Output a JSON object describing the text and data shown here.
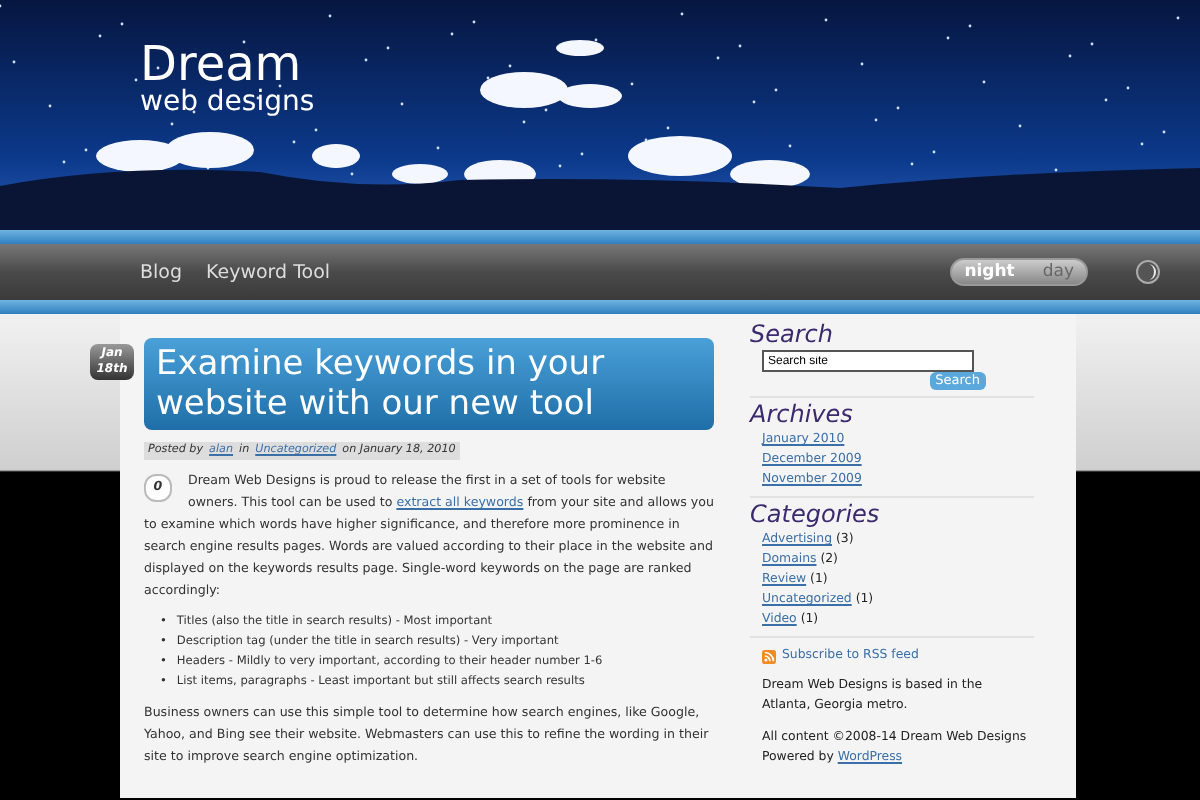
{
  "site": {
    "title": "Dream",
    "subtitle": "web designs"
  },
  "nav": {
    "links": [
      {
        "label": "Blog"
      },
      {
        "label": "Keyword Tool"
      }
    ],
    "theme_toggle": [
      {
        "label": "night",
        "selected": true
      },
      {
        "label": "day",
        "selected": false
      }
    ]
  },
  "post": {
    "date": {
      "month": "Jan",
      "day": "18th"
    },
    "title": "Examine keywords in your website with our new tool",
    "meta": {
      "prefix": "Posted by",
      "author": "alan",
      "middle": "in",
      "category": "Uncategorized",
      "suffix": "on January 18, 2010"
    },
    "comment_count": "0",
    "intro": [
      {
        "kind": "text",
        "text": "Dream Web Designs is proud to release the first in a set of tools for website owners. This tool can be used to "
      },
      {
        "kind": "link",
        "text": "extract all keywords"
      },
      {
        "kind": "text",
        "text": " from your site and allows you to examine which words have higher significance, and therefore more prominence in search engine results pages. Words are valued according to their place in the website and displayed on the keywords results page. Single-word keywords on the page are ranked accordingly:"
      }
    ],
    "list": [
      {
        "marker": "•",
        "text": "Titles (also the title in search results) - Most important"
      },
      {
        "marker": "•",
        "text": "Description tag (under the title in search results) - Very important"
      },
      {
        "marker": "•",
        "text": "Headers - Mildly to very important, according to their header number 1-6"
      },
      {
        "marker": "•",
        "text": "List items, paragraphs - Least important but still affects search results"
      }
    ],
    "closing": "Business owners can use this simple tool to determine how search engines, like Google, Yahoo, and Bing see their website. Webmasters can use this to refine the wording in their site to improve search engine optimization."
  },
  "sidebar": {
    "search": {
      "heading": "Search",
      "value": "Search site",
      "button": "Search"
    },
    "archives": {
      "heading": "Archives",
      "links": [
        "January 2010",
        "December 2009",
        "November 2009"
      ]
    },
    "categories": {
      "heading": "Categories",
      "items": [
        {
          "label": "Advertising",
          "count": "(3)"
        },
        {
          "label": "Domains",
          "count": "(2)"
        },
        {
          "label": "Review",
          "count": "(1)"
        },
        {
          "label": "Uncategorized",
          "count": "(1)"
        },
        {
          "label": "Video",
          "count": "(1)"
        }
      ]
    },
    "rss": "Subscribe to RSS feed",
    "about": "Dream Web Designs is based in the Atlanta, Georgia metro.",
    "copyright": "All content ©2008-14 Dream Web Designs",
    "powered": {
      "prefix": "Powered by",
      "link": "WordPress"
    }
  }
}
